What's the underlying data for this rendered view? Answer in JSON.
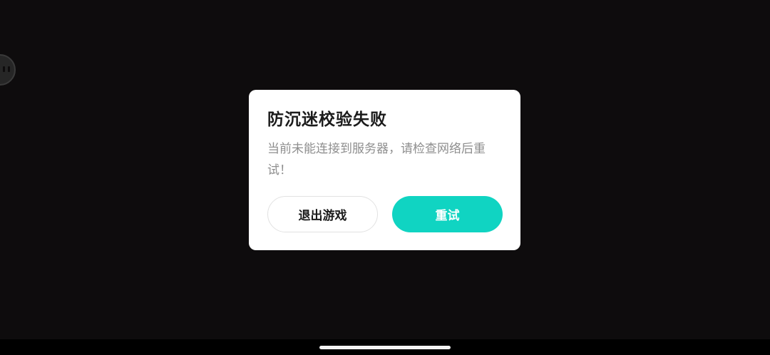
{
  "dialog": {
    "title": "防沉迷校验失败",
    "message": "当前未能连接到服务器，请检查网络后重试！",
    "exit_label": "退出游戏",
    "retry_label": "重试"
  },
  "colors": {
    "background": "#0e0c0d",
    "dialog_bg": "#ffffff",
    "accent": "#10d4c2",
    "title_text": "#1b1b1b",
    "message_text": "#8e8e8e"
  },
  "icons": {
    "floating_ball": "assistive-ball-icon"
  }
}
